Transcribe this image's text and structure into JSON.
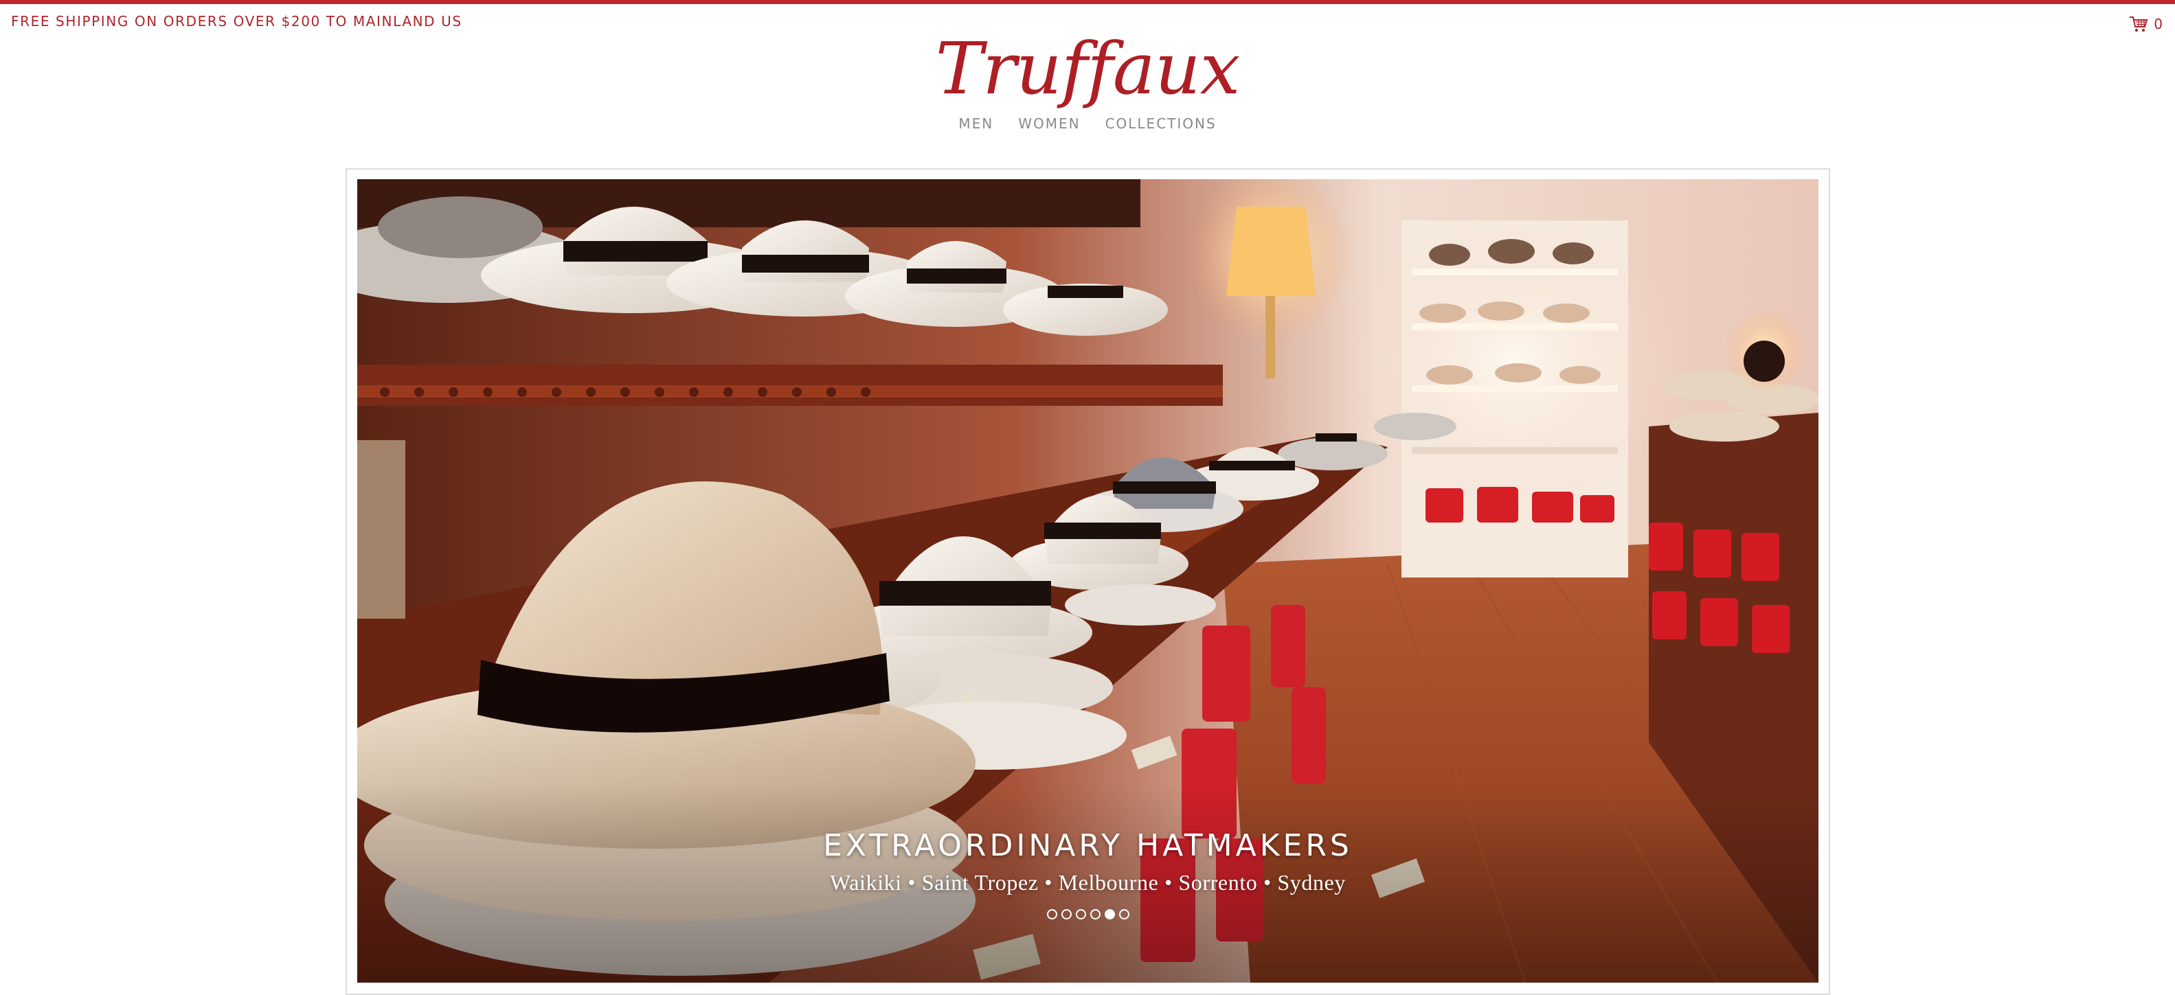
{
  "colors": {
    "brand": "#ad1f25",
    "top_rule": "#c0272d",
    "nav_text": "#8a8a8a"
  },
  "header": {
    "promo_text": "FREE SHIPPING ON ORDERS OVER $200 TO MAINLAND US",
    "logo_text": "Truffaux",
    "cart": {
      "icon": "cart-icon",
      "count": "0"
    }
  },
  "nav": {
    "items": [
      {
        "label": "MEN"
      },
      {
        "label": "WOMEN"
      },
      {
        "label": "COLLECTIONS"
      }
    ]
  },
  "slider": {
    "title": "EXTRAORDINARY HATMAKERS",
    "subtitle": "Waikiki • Saint Tropez • Melbourne • Sorrento • Sydney",
    "slide_count": 6,
    "active_slide": 5
  }
}
